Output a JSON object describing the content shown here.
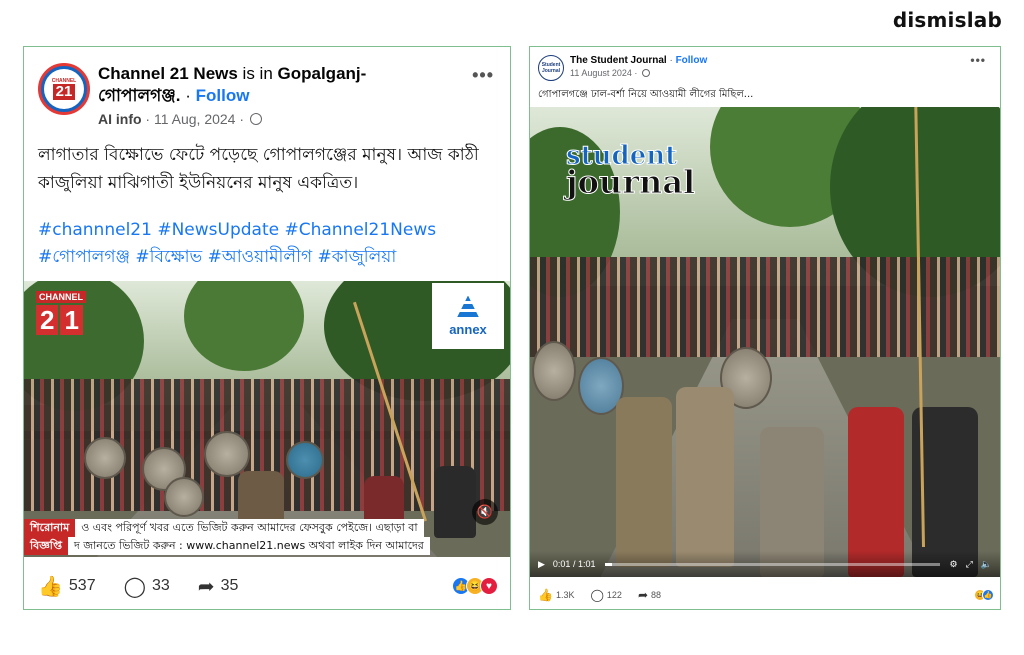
{
  "brand": "dismislab",
  "left_post": {
    "page_name": "Channel 21 News",
    "is_in": " is in ",
    "location": "Gopalganj-গোপালগঞ্জ.",
    "separator": " · ",
    "follow_label": "Follow",
    "ai_info": "AI info",
    "date": " · 11 Aug, 2024 · ",
    "menu": "•••",
    "avatar_text": "CHANNEL",
    "avatar_num": "21",
    "body": "লাগাতার বিক্ষোভে ফেটে পড়েছে গোপালগঞ্জের মানুষ। আজ কাঠী কাজুলিয়া মাঝিগাতী ইউনিয়নের মানুষ একত্রিত।",
    "hashtags": "#channnel21 #NewsUpdate #Channel21News #গোপালগঞ্জ #বিক্ষোভ #আওয়ামীলীগ #কাজুলিয়া",
    "video": {
      "logo_small": "CHANNEL",
      "logo_digits": [
        "2",
        "1"
      ],
      "sponsor": "annex",
      "ticker_tag_1": "শিরোনাম",
      "ticker_msg_1": "ও এবং পরিপূর্ণ খবর এতে ভিজিট করুন আমাদের ফেসবুক পেইজে। এছাড়া বা",
      "ticker_tag_2": "বিজ্ঞপ্তি",
      "ticker_msg_2": "দ জানতে ভিজিট করুন : www.channel21.news অথবা লাইক দিন আমাদের",
      "mute_icon": "speaker-icon"
    },
    "reactions_count": "537",
    "comments_count": "33",
    "shares_count": "35",
    "reaction_colors": [
      "#1877f2",
      "#f7b125",
      "#e41e3f"
    ]
  },
  "right_post": {
    "avatar_text": "Student Journal",
    "page_name": "The Student Journal",
    "separator": " · ",
    "follow_label": "Follow",
    "date": "11 August 2024 · ",
    "menu": "•••",
    "body": "গোপালগঞ্জে ঢাল-বর্শা নিয়ে আওয়ামী লীগের মিছিল...",
    "video": {
      "logo_line1": "student",
      "logo_line2": "journal",
      "time": "0:01 / 1:01",
      "progress": 0.02
    },
    "reactions_count": "1.3K",
    "comments_count": "122",
    "shares_count": "88",
    "reaction_colors": [
      "#f7b125",
      "#1877f2"
    ]
  }
}
